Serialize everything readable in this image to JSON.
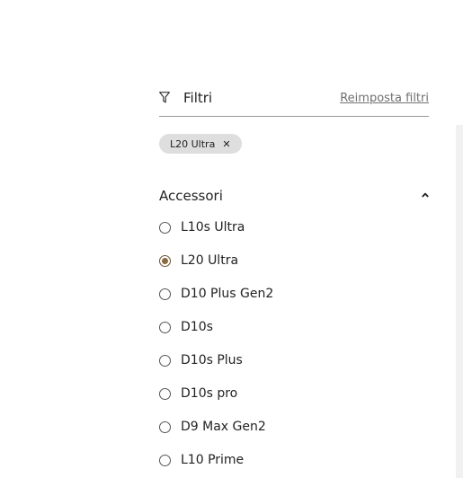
{
  "filters": {
    "title": "Filtri",
    "reset_label": "Reimposta filtri",
    "icon": "funnel-icon"
  },
  "active_chips": [
    {
      "label": "L20 Ultra",
      "close_icon": "close-icon"
    }
  ],
  "section": {
    "title": "Accessori",
    "expanded": true,
    "icon": "chevron-up-icon",
    "options": [
      {
        "label": "L10s Ultra",
        "checked": false
      },
      {
        "label": "L20 Ultra",
        "checked": true
      },
      {
        "label": "D10 Plus Gen2",
        "checked": false
      },
      {
        "label": "D10s",
        "checked": false
      },
      {
        "label": "D10s Plus",
        "checked": false
      },
      {
        "label": "D10s pro",
        "checked": false
      },
      {
        "label": "D9 Max Gen2",
        "checked": false
      },
      {
        "label": "L10 Prime",
        "checked": false
      }
    ]
  },
  "colors": {
    "accent": "#8c6a3f",
    "chip_bg": "#dedede",
    "link": "#707070"
  }
}
